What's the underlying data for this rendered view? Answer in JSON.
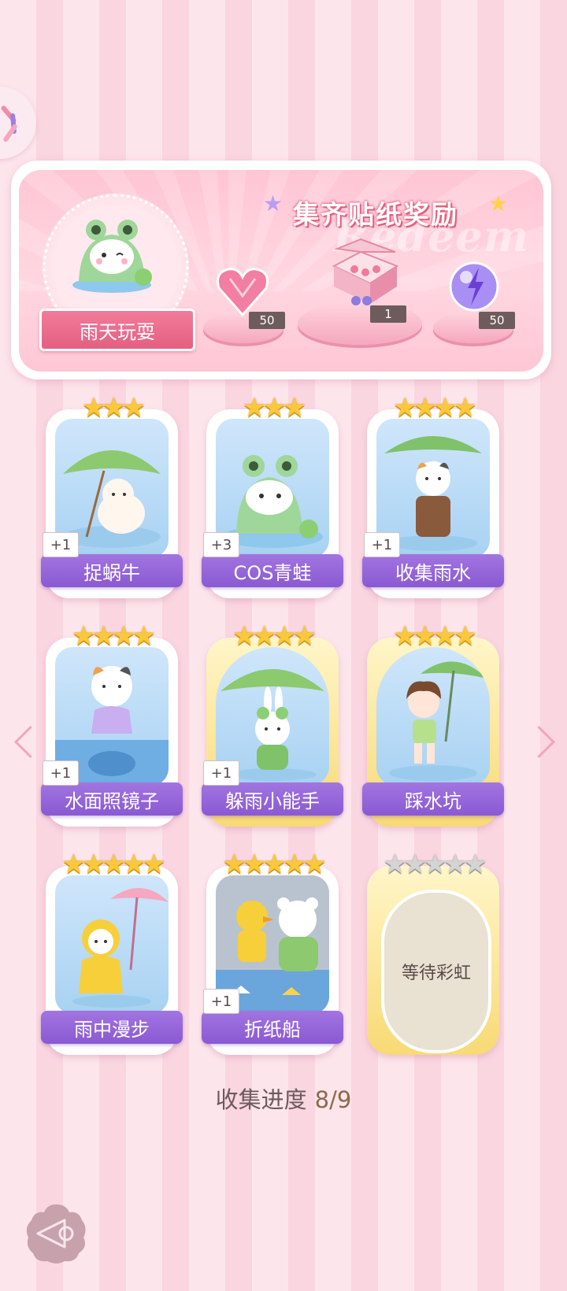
{
  "banner": {
    "title": "集齐贴纸奖励",
    "ghost_text": "Redeem",
    "theme_name": "雨天玩耍",
    "rewards": [
      {
        "icon": "pink-heart-gem-icon",
        "count": "50"
      },
      {
        "icon": "gift-box-icon",
        "count": "1"
      },
      {
        "icon": "purple-lightning-orb-icon",
        "count": "50"
      }
    ]
  },
  "cards": [
    {
      "label": "捉蜗牛",
      "stars": "★★★",
      "badge": "+1",
      "art": "puppy-leaf-umbrella"
    },
    {
      "label": "COS青蛙",
      "stars": "★★★",
      "badge": "+3",
      "art": "frog-costume-cat"
    },
    {
      "label": "收集雨水",
      "stars": "★★★★",
      "badge": "+1",
      "art": "calico-cat-leaf"
    },
    {
      "label": "水面照镜子",
      "stars": "★★★★",
      "badge": "+1",
      "art": "cat-puddle-reflection"
    },
    {
      "label": "躲雨小能手",
      "stars": "★★★★",
      "badge": "+1",
      "art": "bunny-frog-hat"
    },
    {
      "label": "踩水坑",
      "stars": "★★★★",
      "badge": "",
      "art": "girl-frog-umbrella"
    },
    {
      "label": "雨中漫步",
      "stars": "★★★★★",
      "badge": "",
      "art": "cat-yellow-raincoat"
    },
    {
      "label": "折纸船",
      "stars": "★★★★★",
      "badge": "+1",
      "art": "duck-and-bear"
    }
  ],
  "locked_card": {
    "label": "等待彩虹",
    "stars": "★★★★★"
  },
  "progress": {
    "label": "收集进度",
    "value": "8/9"
  },
  "colors": {
    "accent_pink": "#e45f82",
    "label_purple": "#8a59d3",
    "star_gold": "#f9c93b"
  }
}
